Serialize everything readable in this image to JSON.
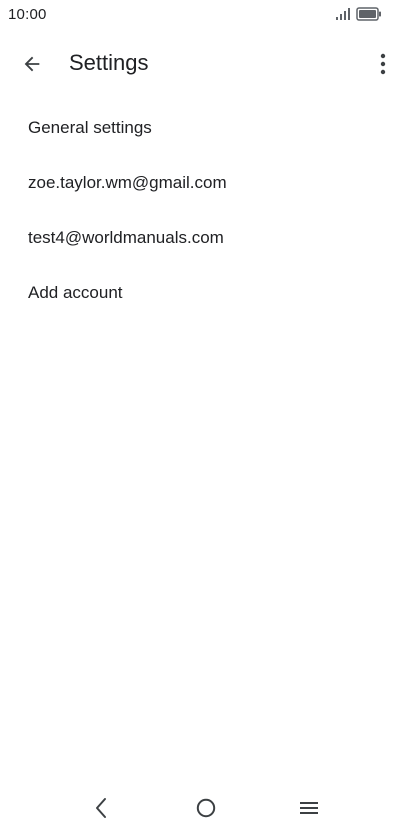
{
  "status_bar": {
    "time": "10:00",
    "icons": [
      "signal-icon",
      "battery-icon"
    ]
  },
  "app_bar": {
    "title": "Settings",
    "icons": [
      "back-arrow-icon",
      "more-vert-icon"
    ]
  },
  "settings": {
    "items": [
      {
        "label": "General settings"
      },
      {
        "label": "zoe.taylor.wm@gmail.com"
      },
      {
        "label": "test4@worldmanuals.com"
      },
      {
        "label": "Add account"
      }
    ]
  },
  "nav_bar": {
    "icons": [
      "nav-back-icon",
      "nav-home-icon",
      "nav-recents-icon"
    ]
  },
  "colors": {
    "text": "#202124",
    "icon": "#5f6368",
    "background": "#ffffff"
  }
}
